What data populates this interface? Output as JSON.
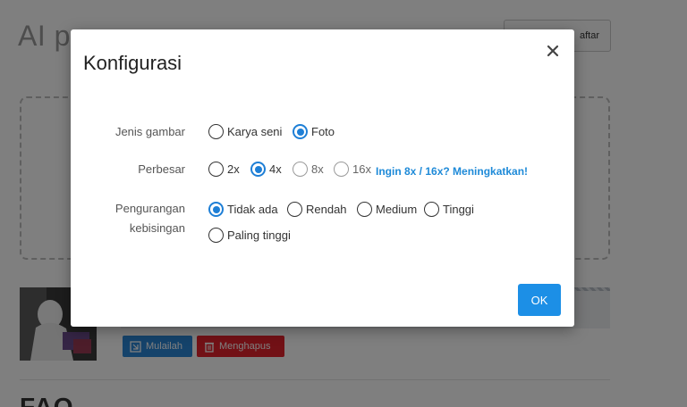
{
  "background": {
    "title": "AI p",
    "signup_label": "aftar",
    "start_label": "Mulailah",
    "delete_label": "Menghapus",
    "faq_heading": "FAQ"
  },
  "modal": {
    "title": "Konfigurasi",
    "close_icon": "close-icon",
    "image_type": {
      "label": "Jenis gambar",
      "options": [
        "Karya seni",
        "Foto"
      ],
      "selected": "Foto"
    },
    "upscale": {
      "label": "Perbesar",
      "options": [
        "2x",
        "4x",
        "8x",
        "16x"
      ],
      "selected": "4x",
      "disabled": [
        "8x",
        "16x"
      ],
      "upgrade_link": "Ingin 8x / 16x? Meningkatkan!"
    },
    "denoise": {
      "label_line1": "Pengurangan",
      "label_line2": "kebisingan",
      "options": [
        "Tidak ada",
        "Rendah",
        "Medium",
        "Tinggi",
        "Paling tinggi"
      ],
      "selected": "Tidak ada"
    },
    "ok_label": "OK"
  },
  "colors": {
    "accent": "#1e7fd6",
    "ok_button": "#1c8fe6",
    "start_button": "#2b86d6",
    "delete_button": "#e4232d",
    "link": "#1e8ad8"
  }
}
